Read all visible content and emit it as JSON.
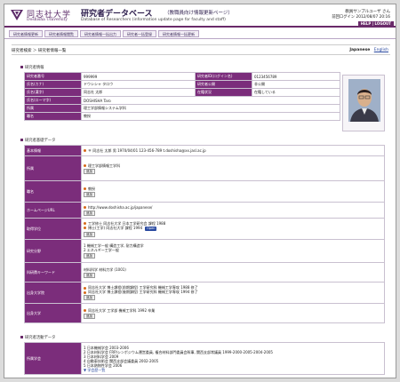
{
  "header": {
    "university_ja": "同志社大学",
    "university_en": "Doshisha University",
    "db_title": "研究者データベース",
    "db_subtitle": "（教職員向け情報更新ページ）",
    "db_subtitle_en": "Database of Researchers (information update page for faculty and staff)",
    "user_name": "教員サンプルユーザ さん",
    "last_login": "前回ログイン 2012/08/07 20:16",
    "help_logout": "HELP | LOGOUT"
  },
  "nav": {
    "tabs": [
      "研究者情報更新",
      "研究者情報閲覧",
      "研究者情報一括出力",
      "研究者一括登録",
      "研究者情報一括更新"
    ]
  },
  "breadcrumb": "研究者検索 ＞ 研究者情報一覧",
  "language": {
    "current": "Japanese",
    "other": "English"
  },
  "basic_section": {
    "heading": "研究者情報",
    "rows": [
      {
        "label": "研究者番号",
        "value": "999999",
        "label2": "研究者ID(ログイン名)",
        "value2": "0123456789"
      },
      {
        "label": "氏名(カナ)",
        "value": "ドウシシャ タロウ",
        "label2": "研究者公開",
        "value2": "非公開"
      },
      {
        "label": "氏名(漢字)",
        "value": "同志社 太郎",
        "label2": "在籍状況",
        "value2": "在籍している"
      },
      {
        "label": "氏名(ローマ字)",
        "value": "DOSHISHA Taro",
        "label2": "",
        "value2": ""
      },
      {
        "label": "所属",
        "value": "理工学部情報システム学科",
        "label2": "",
        "value2": ""
      },
      {
        "label": "職名",
        "value": "教授",
        "label2": "",
        "value2": ""
      }
    ]
  },
  "basic_data_section": {
    "heading": "研究者基礎データ",
    "contact": "〒 同志社 太郎 男  1970/04/01   123-456-789  t.doshisha@xx.jasl.ac.jp",
    "affiliation_item": "理工学部情報工学科",
    "position_item": "教授",
    "url": "http://www.doshisha.ac.jp/japanese/",
    "degree_1": "工学修士  同志社大学  日本工学研究会  課程  1988",
    "degree_2": "博士(工学)  同志社大学  課程  1994",
    "degree_badge": "Open",
    "field_1": "機械工学一般  構造工学, 耐力構造学",
    "field_2": "エネルギー工学一般",
    "keywords": "材料科学 材料力学 (1001)",
    "edu_1": "同志社大学  博士課程(前期課程)  工学研究科  機械工学専攻  1988  修了",
    "edu_2": "同志社大学  博士課程(後期課程)  工学研究科  機械工学専攻  1994  修了",
    "career": "同志社大学  工学部  機械工学科  1992  卒業",
    "edit_label": "追加",
    "labels": {
      "contact": "基本情報",
      "affiliation": "所属",
      "position": "職名",
      "homepage": "ホームページURL",
      "degree": "取得学位",
      "field": "研究分野",
      "keyword": "科研費キーワード",
      "education": "出身大学院",
      "career": "出身大学"
    }
  },
  "activity_section": {
    "heading": "研究者活動データ",
    "label": "所属学会",
    "items": [
      "1  日本機械学会  2003-2006",
      "2  日本材料学会  FRP/シンポジウム運営委員, 複合材料部門委員会幹事, 関西支部常議員  1999-2000-2005-2004-2005",
      "3  日本材料学会  2009",
      "4  自動車技術会  関西支部会議委員  2002-2005",
      "5  日本熱物性学会  2006"
    ],
    "more": "▼ 学会歴一覧"
  }
}
